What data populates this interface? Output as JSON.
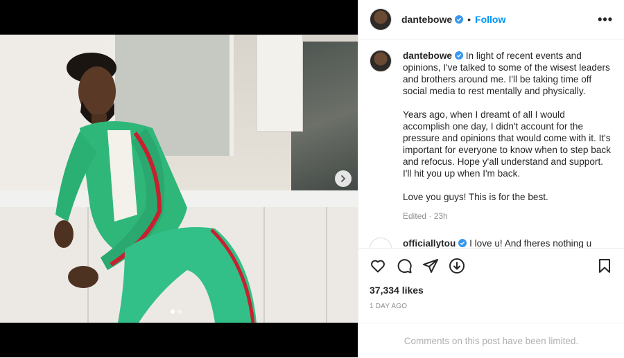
{
  "post": {
    "username": "dantebowe",
    "follow_label": "Follow",
    "separator": "•",
    "more_label": "•••",
    "caption": {
      "username": "dantebowe",
      "paragraphs": [
        "In light of recent events and opinions, I've talked to some of the wisest leaders and brothers around me. I'll be taking time off social media to rest mentally and physically.",
        "Years ago, when I dreamt of all I would accomplish one day, I didn't account for the pressure and opinions that would come with it. It's important for everyone to know when to step back and refocus. Hope y'all understand and support. I'll hit you up when I'm back.",
        "Love you guys! This is for the best."
      ],
      "meta": "Edited · 23h"
    },
    "comment": {
      "username": "officiallytou",
      "text": "I love u! And fheres nothing u"
    },
    "likes": "37,334 likes",
    "date": "1 DAY AGO",
    "comments_limited": "Comments on this post have been limited."
  },
  "icons": {
    "verified": "verified-badge-icon",
    "like": "heart-icon",
    "comment": "comment-bubble-icon",
    "share": "paper-plane-icon",
    "save_circle": "download-circle-icon",
    "bookmark": "bookmark-icon",
    "next": "chevron-right-icon"
  },
  "colors": {
    "accent": "#0095f6",
    "verified": "#3897f0",
    "jacket": "#2fb77a",
    "stripe": "#c8202f"
  }
}
